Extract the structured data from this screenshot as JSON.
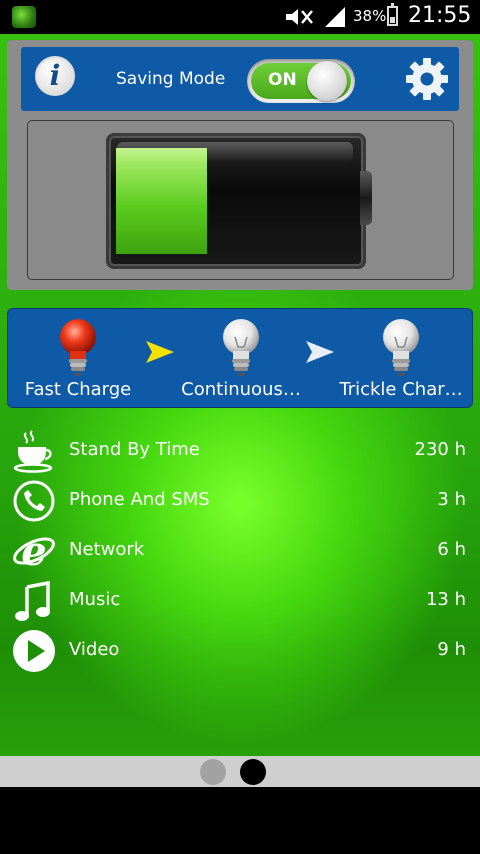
{
  "status_bar": {
    "battery_percent": "38%",
    "battery_level": 0.38,
    "time": "21:55",
    "icons": [
      "app-icon",
      "mute-icon",
      "signal-icon",
      "battery-icon"
    ]
  },
  "header": {
    "info_label": "i",
    "saving_mode_label": "Saving Mode",
    "toggle_label": "ON",
    "toggle_state": true
  },
  "battery": {
    "charge_level": 0.38,
    "fill_color": "#5ccc1e"
  },
  "charge_stages": [
    {
      "label": "Fast Charge",
      "active": true,
      "icon": "bulb-icon-red"
    },
    {
      "label": "Continuous…",
      "active": false,
      "icon": "bulb-icon-white"
    },
    {
      "label": "Trickle Char…",
      "active": false,
      "icon": "bulb-icon-white"
    }
  ],
  "stats": [
    {
      "label": "Stand By Time",
      "value": "230 h",
      "icon": "coffee-cup-icon"
    },
    {
      "label": "Phone And SMS",
      "value": "3 h",
      "icon": "phone-icon"
    },
    {
      "label": "Network",
      "value": "6 h",
      "icon": "internet-explorer-icon"
    },
    {
      "label": "Music",
      "value": "13 h",
      "icon": "music-note-icon"
    },
    {
      "label": "Video",
      "value": "9 h",
      "icon": "play-icon"
    }
  ],
  "pager": {
    "page_count": 2,
    "current_page": 2
  },
  "colors": {
    "panel_blue": "#0e5aa7",
    "accent_green": "#4aa81a",
    "arrow_yellow": "#f5e000"
  }
}
